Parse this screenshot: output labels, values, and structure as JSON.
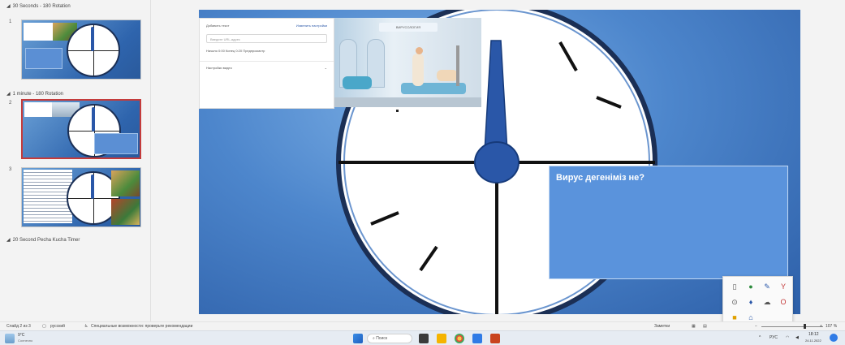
{
  "sidebar": {
    "sections": [
      {
        "title": "30 Seconds - 180 Rotation"
      },
      {
        "title": "1 minute - 180 Rotation"
      },
      {
        "title": "20 Second Pecha Kucha Timer"
      }
    ],
    "slides": [
      {
        "number": "1"
      },
      {
        "number": "2"
      },
      {
        "number": "3"
      }
    ]
  },
  "slide": {
    "question": "Вирус дегеніміз не?",
    "clock": {
      "face_color": "#ffffff",
      "rim_color": "#1b2f55",
      "hand_color": "#2a57a8"
    },
    "overlay": {
      "row1": "Добавить текст",
      "row1_link": "Изменить настройки",
      "input_placeholder": "Введите URL-адрес",
      "row3": "Начало  0:00  Конец  0:20  Предпросмотр",
      "row4": "Настройки видео"
    },
    "video_title": "ВИРУСОЛОГИЯ"
  },
  "statusbar": {
    "slide_info": "Слайд 2 из 3",
    "language": "русский",
    "accessibility": "Специальные возможности: проверьте рекомендации",
    "notes": "Заметки",
    "zoom": "107 %"
  },
  "taskbar": {
    "weather": "9°C",
    "weather_desc": "Солнечно",
    "search_placeholder": "Поиск",
    "lang": "РУС",
    "time": "18:12",
    "date": "24.11.2022"
  },
  "colors": {
    "slide_bg": "#4d86cc",
    "question_box": "#5a93dc",
    "selected_border": "#c43b3b"
  }
}
